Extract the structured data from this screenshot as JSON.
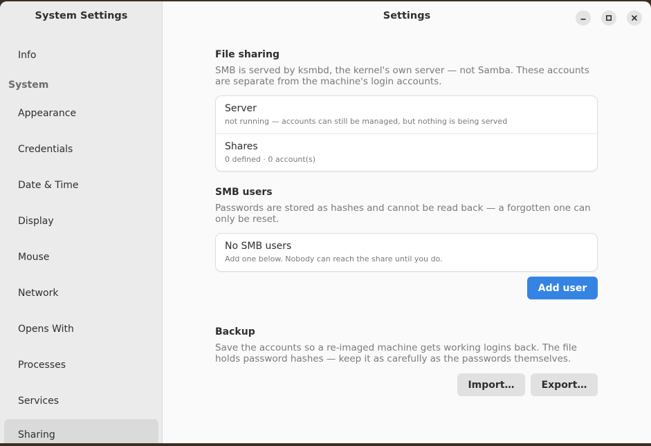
{
  "sidebar": {
    "title": "System Settings",
    "items": [
      {
        "label": "Info"
      },
      {
        "heading": "System"
      },
      {
        "label": "Appearance"
      },
      {
        "label": "Credentials"
      },
      {
        "label": "Date & Time"
      },
      {
        "label": "Display"
      },
      {
        "label": "Mouse"
      },
      {
        "label": "Network"
      },
      {
        "label": "Opens With"
      },
      {
        "label": "Processes"
      },
      {
        "label": "Services"
      },
      {
        "label": "Sharing"
      }
    ],
    "active": "Sharing"
  },
  "header": {
    "title": "Settings",
    "minimize_icon": "minimize-icon",
    "maximize_icon": "maximize-icon",
    "close_icon": "close-icon"
  },
  "file_sharing": {
    "title": "File sharing",
    "description": "SMB is served by ksmbd, the kernel's own server — not Samba. These accounts are separate from the machine's login accounts.",
    "server": {
      "title": "Server",
      "subtitle": "not running — accounts can still be managed, but nothing is being served"
    },
    "shares": {
      "title": "Shares",
      "subtitle": "0 defined · 0 account(s)"
    }
  },
  "smb_users": {
    "title": "SMB users",
    "description": "Passwords are stored as hashes and cannot be read back — a forgotten one can only be reset.",
    "empty": {
      "title": "No SMB users",
      "subtitle": "Add one below. Nobody can reach the share until you do."
    },
    "add_label": "Add user"
  },
  "backup": {
    "title": "Backup",
    "description": "Save the accounts so a re-imaged machine gets working logins back. The file holds password hashes — keep it as carefully as the passwords themselves.",
    "import_label": "Import…",
    "export_label": "Export…"
  },
  "colors": {
    "accent": "#3584e4"
  }
}
